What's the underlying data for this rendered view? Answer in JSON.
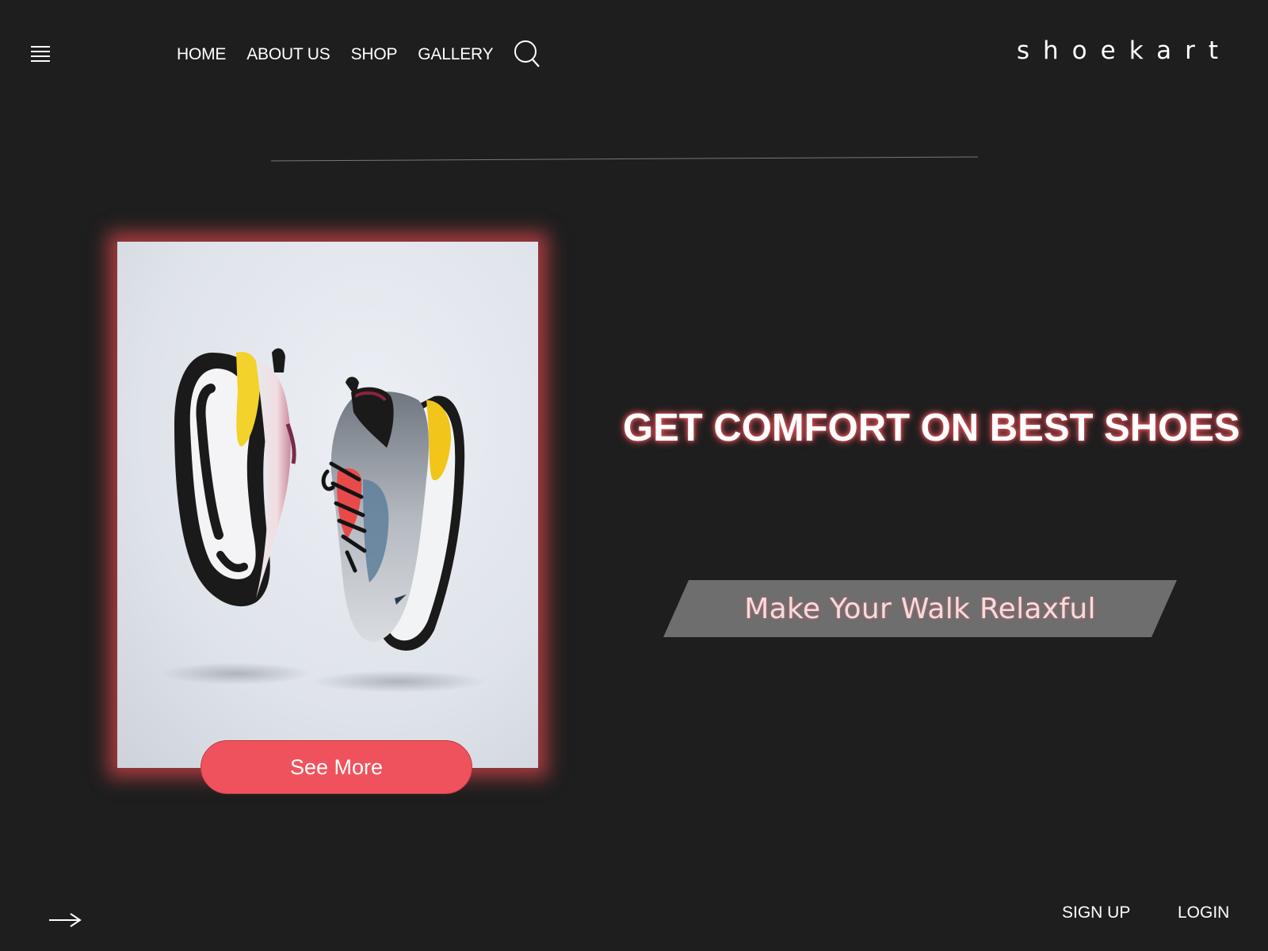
{
  "header": {
    "menu_icon": "hamburger-menu-icon",
    "nav": [
      {
        "label": "HOME"
      },
      {
        "label": "ABOUT US"
      },
      {
        "label": "SHOP"
      },
      {
        "label": "GALLERY"
      }
    ],
    "search_icon": "search-icon",
    "brand": "shoekart"
  },
  "hero": {
    "headline": "GET COMFORT ON BEST SHOES",
    "tagline": "Make Your Walk Relaxful",
    "card": {
      "image": "pair-of-sneakers-photo",
      "button_label": "See More"
    }
  },
  "footer": {
    "arrow_icon": "arrow-right-icon",
    "signup_label": "SIGN UP",
    "login_label": "LOGIN"
  },
  "colors": {
    "background": "#1e1e1e",
    "accent": "#f0525d",
    "glow": "#d2464b",
    "banner": "#6e6e6e"
  }
}
